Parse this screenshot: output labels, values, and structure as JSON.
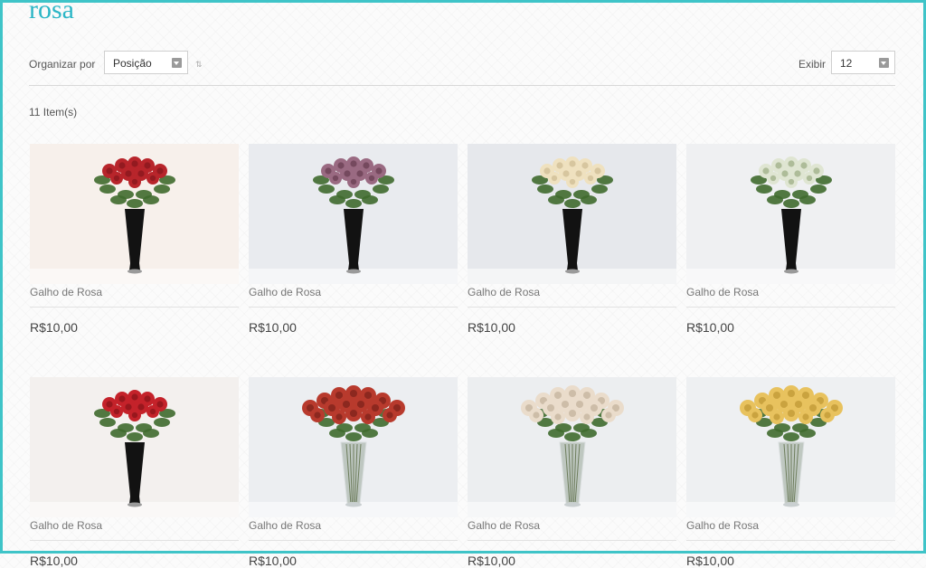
{
  "page": {
    "title": "rosa"
  },
  "toolbar": {
    "sort_label": "Organizar por",
    "sort_value": "Posição",
    "show_label": "Exibir",
    "show_value": "12"
  },
  "items_count": "11 Item(s)",
  "products": [
    {
      "name": "Galho de Rosa",
      "price": "R$10,00",
      "bloom_color": "#b8252b",
      "bloom_dark": "#7a1419",
      "bg": "#f7f0eb",
      "vase": "black-tall"
    },
    {
      "name": "Galho de Rosa",
      "price": "R$10,00",
      "bloom_color": "#9a6a82",
      "bloom_dark": "#5e3346",
      "bg": "#e9ebef",
      "vase": "black-tall"
    },
    {
      "name": "Galho de Rosa",
      "price": "R$10,00",
      "bloom_color": "#efe1bf",
      "bloom_dark": "#c7b48a",
      "bg": "#e6e8ec",
      "vase": "black-tall"
    },
    {
      "name": "Galho de Rosa",
      "price": "R$10,00",
      "bloom_color": "#dfe5d2",
      "bloom_dark": "#8da073",
      "bg": "#eff0f2",
      "vase": "black-tall"
    },
    {
      "name": "Galho de Rosa",
      "price": "R$10,00",
      "bloom_color": "#c4222a",
      "bloom_dark": "#7c1016",
      "bg": "#f3f0ee",
      "vase": "black-tall"
    },
    {
      "name": "Galho de Rosa",
      "price": "R$10,00",
      "bloom_color": "#b83a2d",
      "bloom_dark": "#6e1c16",
      "bg": "#eceef1",
      "vase": "glass"
    },
    {
      "name": "Galho de Rosa",
      "price": "R$10,00",
      "bloom_color": "#eadccb",
      "bloom_dark": "#b9a891",
      "bg": "#eceef0",
      "vase": "glass"
    },
    {
      "name": "Galho de Rosa",
      "price": "R$10,00",
      "bloom_color": "#e8c25e",
      "bloom_dark": "#b68d2c",
      "bg": "#eef0f2",
      "vase": "glass"
    }
  ]
}
